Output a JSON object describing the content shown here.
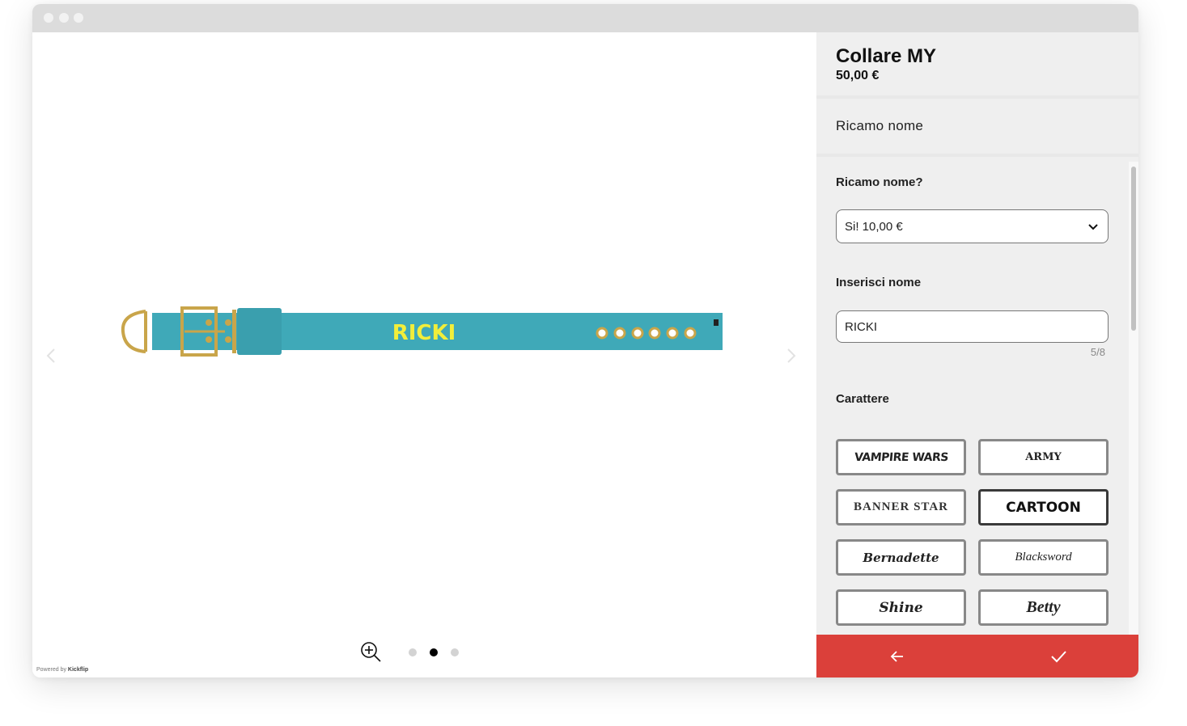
{
  "window": {
    "controls": [
      "close",
      "minimize",
      "maximize"
    ]
  },
  "viewer": {
    "prev_icon": "chevron-left-icon",
    "next_icon": "chevron-right-icon",
    "image_text": "RICKI",
    "zoom_icon": "zoom-in-icon",
    "pages": [
      {
        "active": false
      },
      {
        "active": true
      },
      {
        "active": false
      }
    ],
    "powered_prefix": "Powered by",
    "powered_brand": "Kickflip"
  },
  "product": {
    "title": "Collare MY",
    "price": "50,00 €"
  },
  "section": {
    "title": "Ricamo nome"
  },
  "form": {
    "embroidery_label": "Ricamo nome?",
    "embroidery_value": "Si! 10,00 €",
    "name_label": "Inserisci nome",
    "name_value": "RICKI",
    "char_count": "5/8",
    "font_label": "Carattere",
    "fonts": [
      {
        "label": "VAMPIRE WARS",
        "selected": false
      },
      {
        "label": "ARMY",
        "selected": false
      },
      {
        "label": "BANNER STAR",
        "selected": false
      },
      {
        "label": "CARTOON",
        "selected": true
      },
      {
        "label": "Bernadette",
        "selected": false
      },
      {
        "label": "Blacksword",
        "selected": false
      },
      {
        "label": "Shine",
        "selected": false
      },
      {
        "label": "Betty",
        "selected": false
      }
    ]
  },
  "footer": {
    "back_icon": "arrow-left-icon",
    "confirm_icon": "check-icon",
    "color": "#db403a"
  },
  "colors": {
    "collar": "#3fa9b8",
    "embroidery": "#f2ee3a",
    "hardware": "#c9a54a"
  }
}
